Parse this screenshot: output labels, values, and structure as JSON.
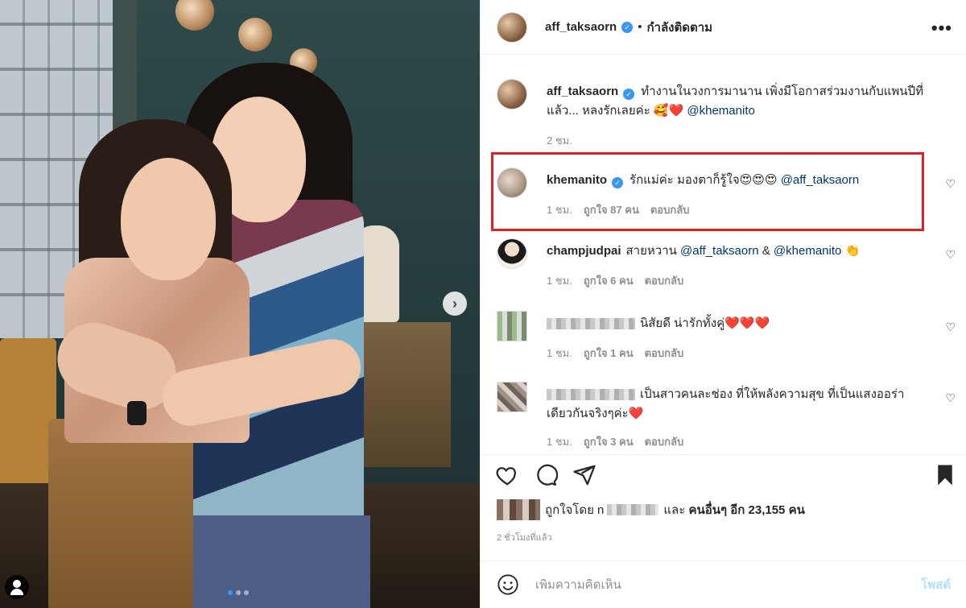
{
  "post": {
    "author": "aff_taksaorn",
    "follow_label": "กำลังติดตาม",
    "dot": "•",
    "more_label": "•••",
    "verified_mark": "✓"
  },
  "caption": {
    "username": "aff_taksaorn",
    "text": "ทำงานในวงการมานาน เพิ่งมีโอกาสร่วมงานกับแพนปีที่แล้ว... หลงรักเลยค่ะ 🥰❤️",
    "mention": "@khemanito",
    "time": "2 ชม."
  },
  "comments": [
    {
      "username": "khemanito",
      "verified": true,
      "text": "รักแม่ค่ะ มองตาก็รู้ใจ😍😍😍",
      "mention": "@aff_taksaorn",
      "mention2": "",
      "time": "1 ชม.",
      "likes": "ถูกใจ 87 คน",
      "reply": "ตอบกลับ"
    },
    {
      "username": "champjudpai",
      "text": "สายหวาน",
      "mention": "@aff_taksaorn",
      "joiner": "&",
      "mention2": "@khemanito",
      "suffix": "👏",
      "time": "1 ชม.",
      "likes": "ถูกใจ 6 คน",
      "reply": "ตอบกลับ"
    },
    {
      "username": "",
      "text": "นิสัยดี น่ารักทั้งคู่❤️❤️❤️",
      "time": "1 ชม.",
      "likes": "ถูกใจ 1 คน",
      "reply": "ตอบกลับ"
    },
    {
      "username": "",
      "text": "เป็นสาวคนละช่อง ที่ให้พลังความสุข ที่เป็นแสงออร่าเดียวกันจริงๆค่ะ❤️",
      "time": "1 ชม.",
      "likes": "ถูกใจ 3 คน",
      "reply": "ตอบกลับ"
    }
  ],
  "likes_summary": {
    "prefix": "ถูกใจโดย",
    "blurred_name": "n",
    "suffix": "และ",
    "others": "คนอื่นๆ อีก 23,155 คน"
  },
  "time_ago": "2 ชั่วโมงที่แล้ว",
  "composer": {
    "placeholder": "เพิ่มความคิดเห็น",
    "post_label": "โพสต์"
  },
  "carousel": {
    "next_label": "›",
    "current_index": 1,
    "total": 3
  },
  "icons": [
    "heart-icon",
    "comment-icon",
    "share-icon",
    "bookmark-icon",
    "emoji-icon",
    "chevron-right-icon",
    "user-tag-icon",
    "verified-icon",
    "more-icon"
  ],
  "colors": {
    "accent": "#3897f0",
    "mention": "#00376b",
    "highlight_box": "#e02020",
    "muted": "#8e8e8e"
  }
}
